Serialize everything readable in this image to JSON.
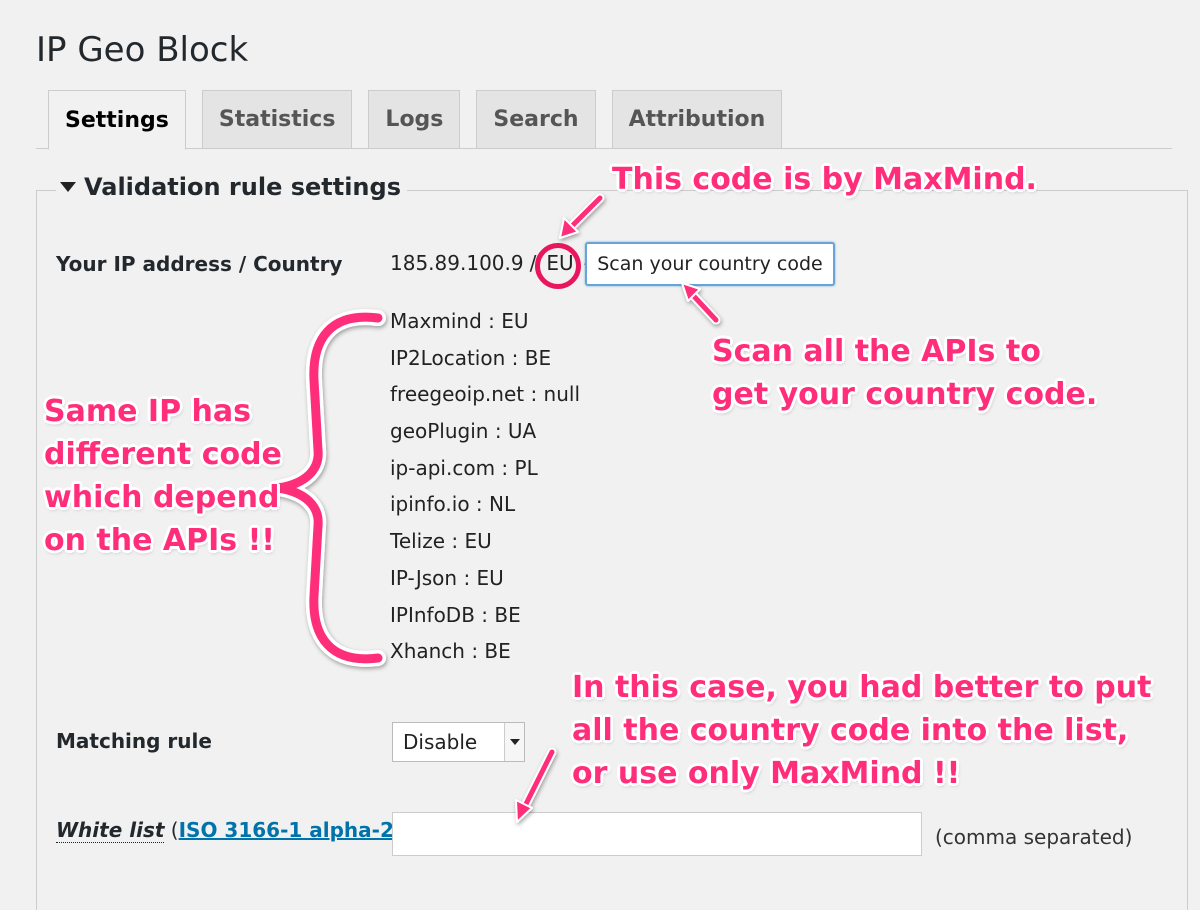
{
  "page_title": "IP Geo Block",
  "tabs": [
    {
      "label": "Settings"
    },
    {
      "label": "Statistics"
    },
    {
      "label": "Logs"
    },
    {
      "label": "Search"
    },
    {
      "label": "Attribution"
    }
  ],
  "section": {
    "title": "Validation rule settings"
  },
  "ip_row": {
    "label": "Your IP address / Country",
    "ip": "185.89.100.9",
    "separator": "/",
    "country": "EU",
    "dash": "-",
    "scan_button": "Scan your country code"
  },
  "api_results": [
    "Maxmind : EU",
    "IP2Location : BE",
    "freegeoip.net : null",
    "geoPlugin : UA",
    "ip-api.com : PL",
    "ipinfo.io : NL",
    "Telize : EU",
    "IP-Json : EU",
    "IPInfoDB : BE",
    "Xhanch : BE"
  ],
  "matching_rule": {
    "label": "Matching rule",
    "selected": "Disable"
  },
  "white_list": {
    "label": "White list",
    "open_paren": "(",
    "link": "ISO 3166-1 alpha-2",
    "close_paren": ")",
    "value": "",
    "note": "(comma separated)"
  },
  "annotations": {
    "maxmind": "This code is by MaxMind.",
    "scan": [
      "Scan all the APIs to",
      "get your country code."
    ],
    "same_ip": [
      "Same IP has",
      "different code",
      "which depend",
      "on the APIs !!"
    ],
    "case": [
      "In this case, you had better to put",
      "all the country code into the list,",
      "or use only MaxMind !!"
    ]
  },
  "colors": {
    "annotation": "#ff2d7a",
    "link": "#0073aa",
    "focus": "#6aa3d9"
  }
}
